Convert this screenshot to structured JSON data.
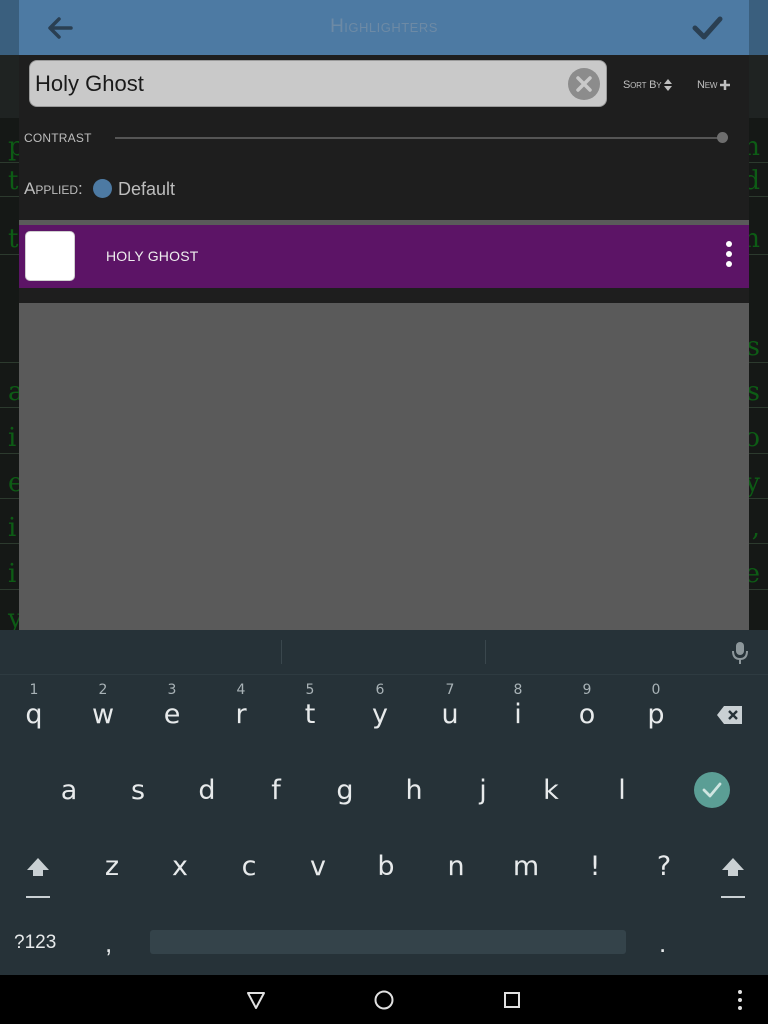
{
  "dialog": {
    "title": "Highlighters",
    "search": {
      "value": "Holy Ghost",
      "placeholder": ""
    },
    "sort_label": "Sort By",
    "new_label": "New",
    "contrast_label": "CONTRAST",
    "contrast_value": 1.0,
    "applied_label": "Applied:",
    "applied_default_label": "Default",
    "list": [
      {
        "label": "HOLY GHOST",
        "color": "#5c1466",
        "swatch": "#ffffff"
      }
    ]
  },
  "background_text": [
    {
      "left": "p",
      "right": "n"
    },
    {
      "left": "t",
      "right": "d"
    },
    {
      "left": "t",
      "right": "n"
    },
    {
      "left": "",
      "right": ""
    },
    {
      "left": "",
      "right": ""
    },
    {
      "left": "",
      "right": "s"
    },
    {
      "left": "a",
      "right": "s"
    },
    {
      "left": "i",
      "right": "o"
    },
    {
      "left": "e",
      "right": "y"
    },
    {
      "left": "i",
      "right": ","
    },
    {
      "left": "i",
      "right": "e"
    },
    {
      "left": "y",
      "right": ""
    }
  ],
  "keyboard": {
    "row1": [
      {
        "ch": "q",
        "num": "1"
      },
      {
        "ch": "w",
        "num": "2"
      },
      {
        "ch": "e",
        "num": "3"
      },
      {
        "ch": "r",
        "num": "4"
      },
      {
        "ch": "t",
        "num": "5"
      },
      {
        "ch": "y",
        "num": "6"
      },
      {
        "ch": "u",
        "num": "7"
      },
      {
        "ch": "i",
        "num": "8"
      },
      {
        "ch": "o",
        "num": "9"
      },
      {
        "ch": "p",
        "num": "0"
      }
    ],
    "row2": [
      "a",
      "s",
      "d",
      "f",
      "g",
      "h",
      "j",
      "k",
      "l"
    ],
    "row3": [
      "z",
      "x",
      "c",
      "v",
      "b",
      "n",
      "m",
      "!",
      "?"
    ],
    "symbols_label": "?123",
    "comma": ",",
    "period": "."
  },
  "colors": {
    "header": "#4d7aa3",
    "accent_row": "#5c1466",
    "keyboard_bg": "#263238",
    "enter_key": "#5b9e95"
  },
  "icons": {
    "back": "arrow-left-icon",
    "confirm": "checkmark-icon",
    "clear": "close-circle-icon",
    "sort": "sort-arrows-icon",
    "new": "plus-icon",
    "row_menu": "more-vertical-icon",
    "mic": "microphone-icon",
    "backspace": "backspace-icon",
    "shift": "shift-icon",
    "enter": "checkmark-circle-icon",
    "nav_back": "triangle-back-icon",
    "nav_home": "circle-home-icon",
    "nav_recent": "square-recents-icon",
    "nav_menu": "more-vertical-icon"
  }
}
